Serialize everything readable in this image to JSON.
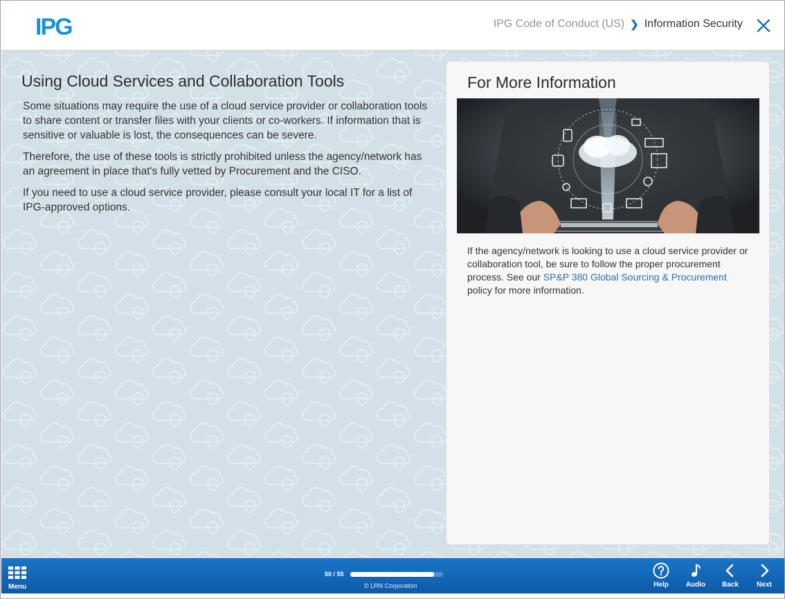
{
  "header": {
    "logo_text": "IPG",
    "breadcrumb_course": "IPG Code of Conduct (US)",
    "breadcrumb_separator": "❯",
    "breadcrumb_current": "Information Security",
    "close_icon": "close-icon"
  },
  "main": {
    "title": "Using Cloud Services and Collaboration Tools",
    "paragraphs": [
      "Some situations may require the use of a cloud service provider or collaboration tools to share content or transfer files with your clients or co-workers. If information that is sensitive or valuable is lost, the consequences can be severe.",
      "Therefore, the use of these tools is strictly prohibited unless the agency/network has an agreement in place that's fully vetted by Procurement and the CISO.",
      "If you need to use a cloud service provider, please consult your local IT for a list of IPG-approved options."
    ]
  },
  "sidebar_card": {
    "title": "For More Information",
    "image": "tablet-cloud-network-illustration",
    "info_before": "If the agency/network is looking to use a cloud service provider or collaboration tool, be sure to follow the proper procurement process. See our ",
    "info_link": "SP&P 380 Global Sourcing & Procurement",
    "info_after": " policy for more information."
  },
  "footer": {
    "menu_label": "Menu",
    "page_count": "50 / 55",
    "progress_fraction": 0.909,
    "copyright": "© LRN Corporation",
    "help_label": "Help",
    "audio_label": "Audio",
    "back_label": "Back",
    "next_label": "Next"
  },
  "colors": {
    "brand_blue": "#1d8fd6",
    "footer_blue": "#1a74c6",
    "content_bg": "#d3e0e8",
    "link": "#2a6db0"
  }
}
